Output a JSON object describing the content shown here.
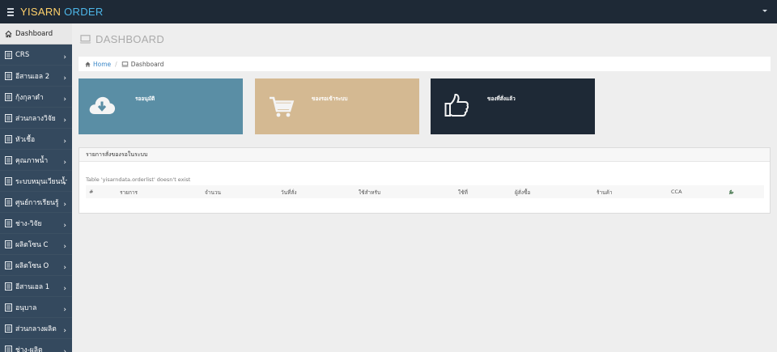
{
  "app": {
    "brand_part1": "YISARN",
    "brand_part2": " ORDER",
    "brand_color1": "#ffd16b",
    "brand_color2": "#4db6e8"
  },
  "sidebar": {
    "items": [
      {
        "label": "Dashboard",
        "icon": "home-icon",
        "active": true
      },
      {
        "label": "CRS",
        "icon": "document-icon"
      },
      {
        "label": "อีสานเอล 2",
        "icon": "document-icon"
      },
      {
        "label": "กุ้งกุลาดำ",
        "icon": "document-icon"
      },
      {
        "label": "ส่วนกลางวิจัย",
        "icon": "document-icon"
      },
      {
        "label": "หัวเชื้อ",
        "icon": "document-icon"
      },
      {
        "label": "คุณภาพน้ำ",
        "icon": "document-icon"
      },
      {
        "label": "ระบบหมุนเวียนน้ำ",
        "icon": "document-icon"
      },
      {
        "label": "ศูนย์การเรียนรู้",
        "icon": "document-icon"
      },
      {
        "label": "ช่าง-วิจัย",
        "icon": "document-icon"
      },
      {
        "label": "ผลิตโซน C",
        "icon": "document-icon"
      },
      {
        "label": "ผลิตโซน O",
        "icon": "document-icon"
      },
      {
        "label": "อีสานเอล 1",
        "icon": "document-icon"
      },
      {
        "label": "อนุบาล",
        "icon": "document-icon"
      },
      {
        "label": "ส่วนกลางผลิต",
        "icon": "document-icon"
      },
      {
        "label": "ช่าง-ผลิต",
        "icon": "document-icon"
      }
    ]
  },
  "page": {
    "title": "DASHBOARD",
    "breadcrumb_home": "Home",
    "breadcrumb_current": "Dashboard"
  },
  "tiles": [
    {
      "label": "รออนุมัติ",
      "icon": "cloud-download-icon",
      "color": "#5a8ea5"
    },
    {
      "label": "ของรอเข้าระบบ",
      "icon": "shopping-cart-icon",
      "color": "#d4b992"
    },
    {
      "label": "ของที่สั่งแล้ว",
      "icon": "thumbs-up-icon",
      "color": "#1e2936"
    }
  ],
  "panel": {
    "title": "รายการสั่งของรอในระบบ",
    "error": "Table 'yisarndata.orderlist' doesn't exist",
    "columns": [
      "#",
      "รายการ",
      "จำนวน",
      "วันที่สั่ง",
      "ใช้สำหรับ",
      "ใช้ที่",
      "ผู้สั่งซื้อ",
      "ร้านค้า",
      "CCA"
    ],
    "action_icon": "wrench-icon"
  }
}
